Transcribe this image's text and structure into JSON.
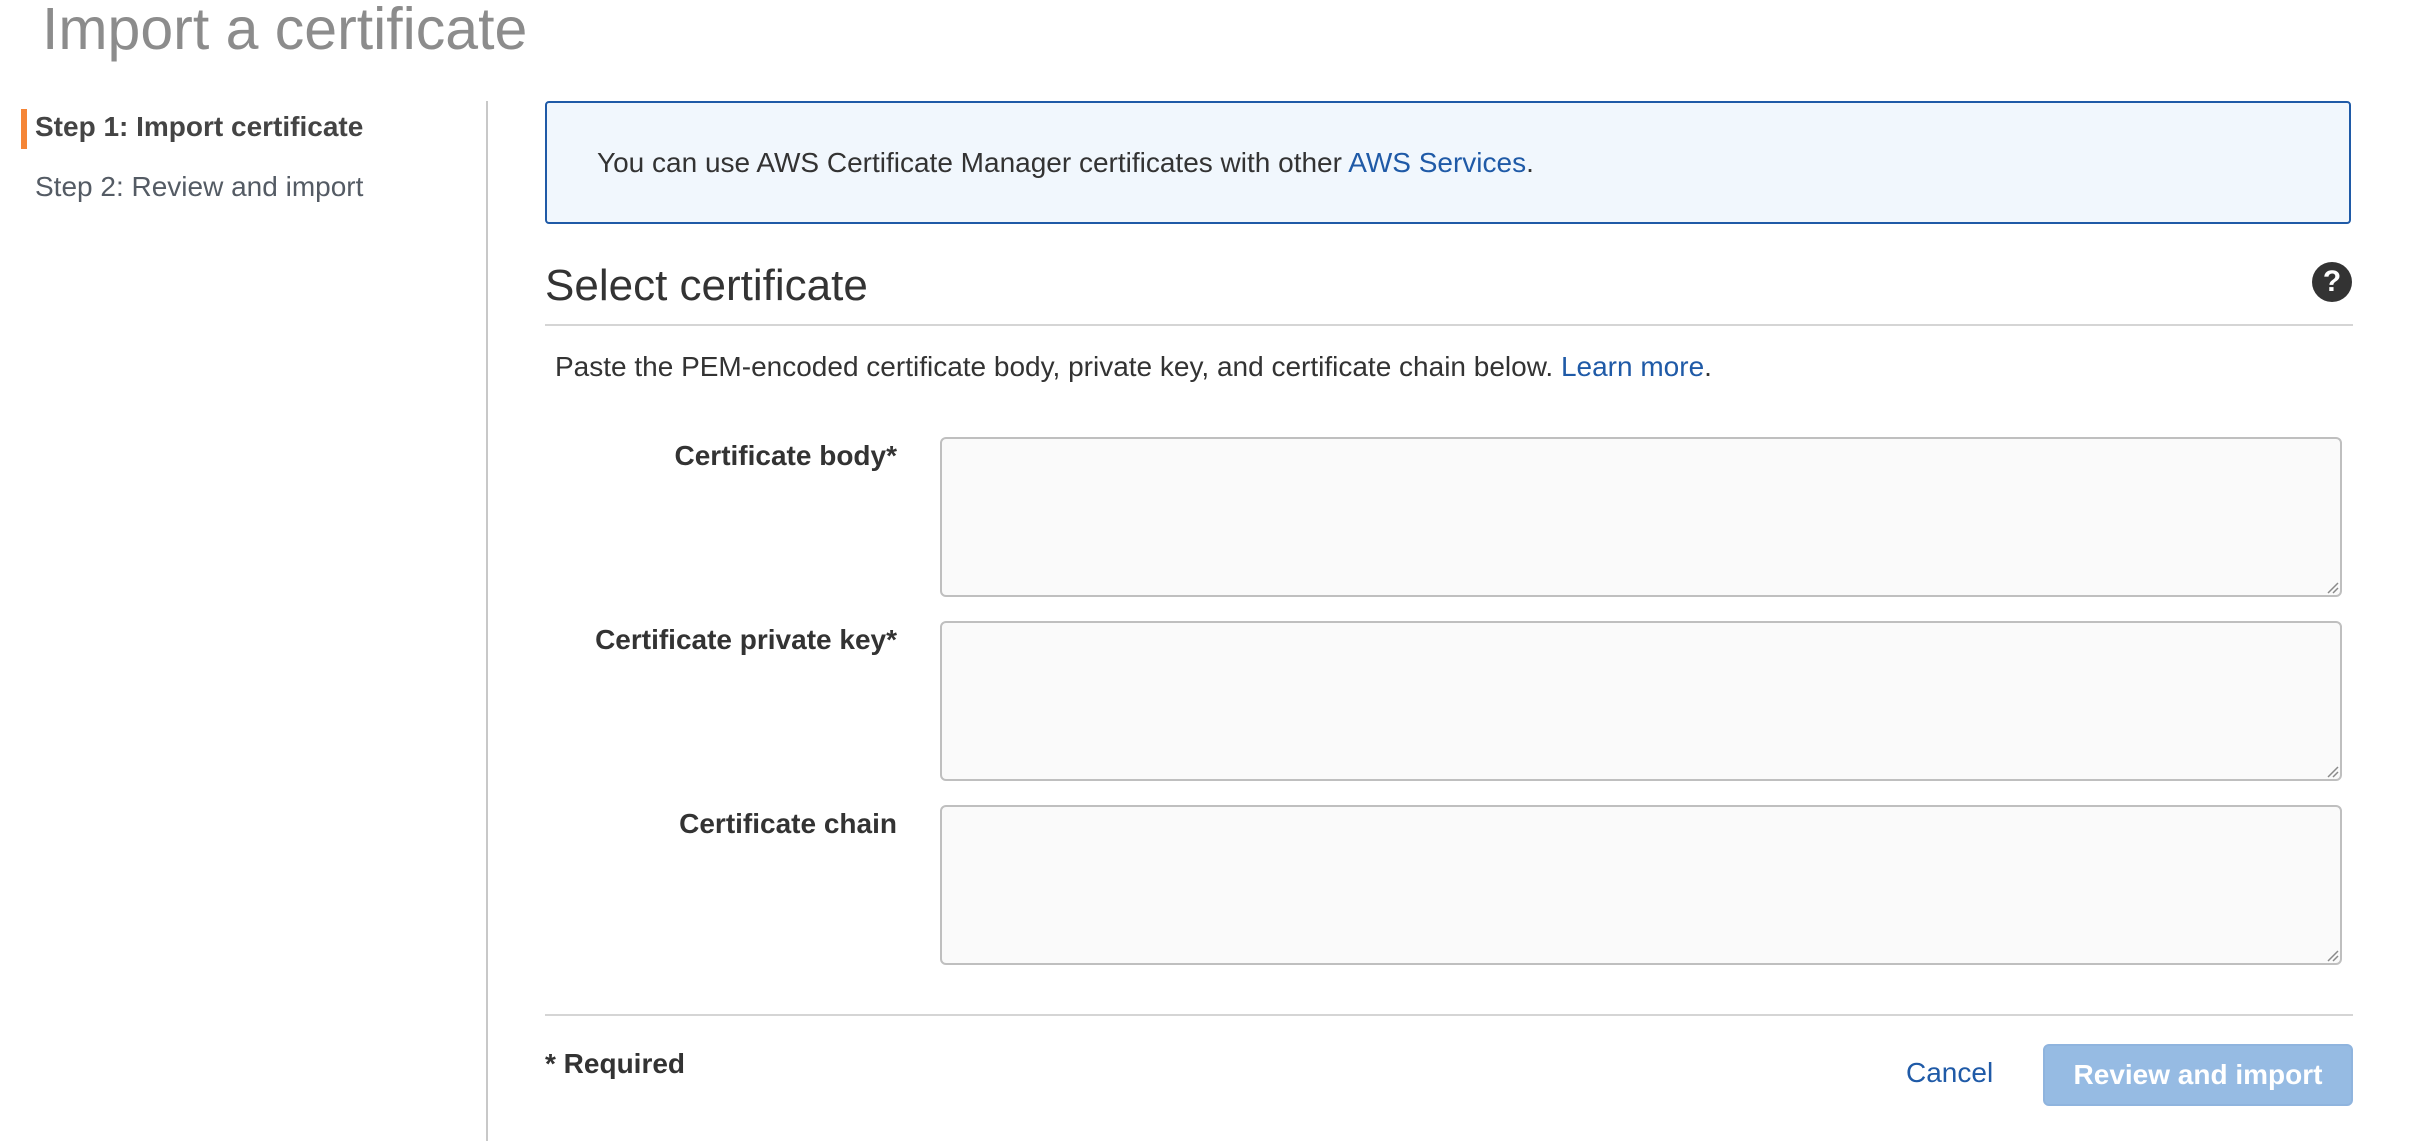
{
  "page": {
    "title": "Import a certificate"
  },
  "sidebar": {
    "steps": [
      {
        "label": "Step 1: Import certificate",
        "active": true
      },
      {
        "label": "Step 2: Review and import",
        "active": false
      }
    ],
    "accent_color": "#f58536"
  },
  "info_box": {
    "text": "You can use AWS Certificate Manager certificates with other ",
    "link_text": "AWS Services",
    "suffix": "."
  },
  "section": {
    "title": "Select certificate",
    "help_icon": "question-circle-icon",
    "description": "Paste the PEM-encoded certificate body, private key, and certificate chain below. ",
    "learn_more": "Learn more",
    "description_suffix": "."
  },
  "fields": [
    {
      "label": "Certificate body*",
      "value": ""
    },
    {
      "label": "Certificate private key*",
      "value": ""
    },
    {
      "label": "Certificate chain",
      "value": ""
    }
  ],
  "footer": {
    "required_note": "* Required",
    "cancel_label": "Cancel",
    "submit_label": "Review and import"
  },
  "colors": {
    "link": "#1f5aa7",
    "info_bg": "#f1f7fd",
    "button_disabled": "#96bbe3"
  }
}
